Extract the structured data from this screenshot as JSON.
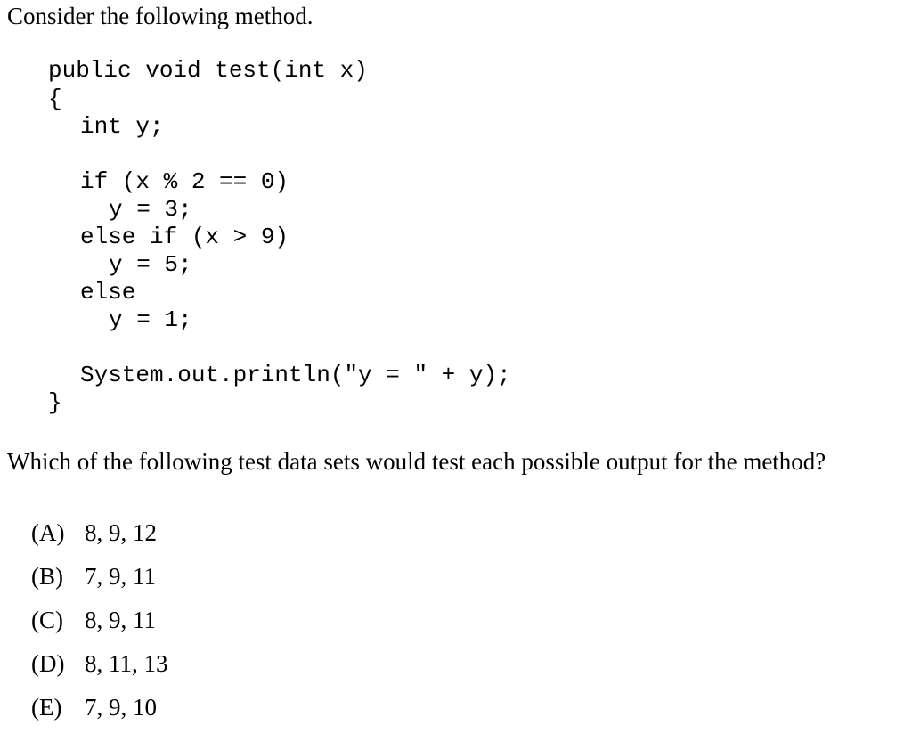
{
  "intro": "Consider the following method.",
  "code": {
    "lines": [
      "public void test(int x)",
      "{",
      "int y;",
      "if (x % 2 == 0)",
      "y = 3;",
      "else if (x > 9)",
      "y = 5;",
      "else",
      "y = 1;",
      "System.out.println(\"y = \" + y);",
      "}"
    ]
  },
  "question": "Which of the following test data sets would test each possible output for the method?",
  "choices": [
    {
      "letter": "(A)",
      "text": "8, 9, 12"
    },
    {
      "letter": "(B)",
      "text": "7, 9, 11"
    },
    {
      "letter": "(C)",
      "text": "8, 9, 11"
    },
    {
      "letter": "(D)",
      "text": "8, 11, 13"
    },
    {
      "letter": "(E)",
      "text": "7, 9, 10"
    }
  ]
}
